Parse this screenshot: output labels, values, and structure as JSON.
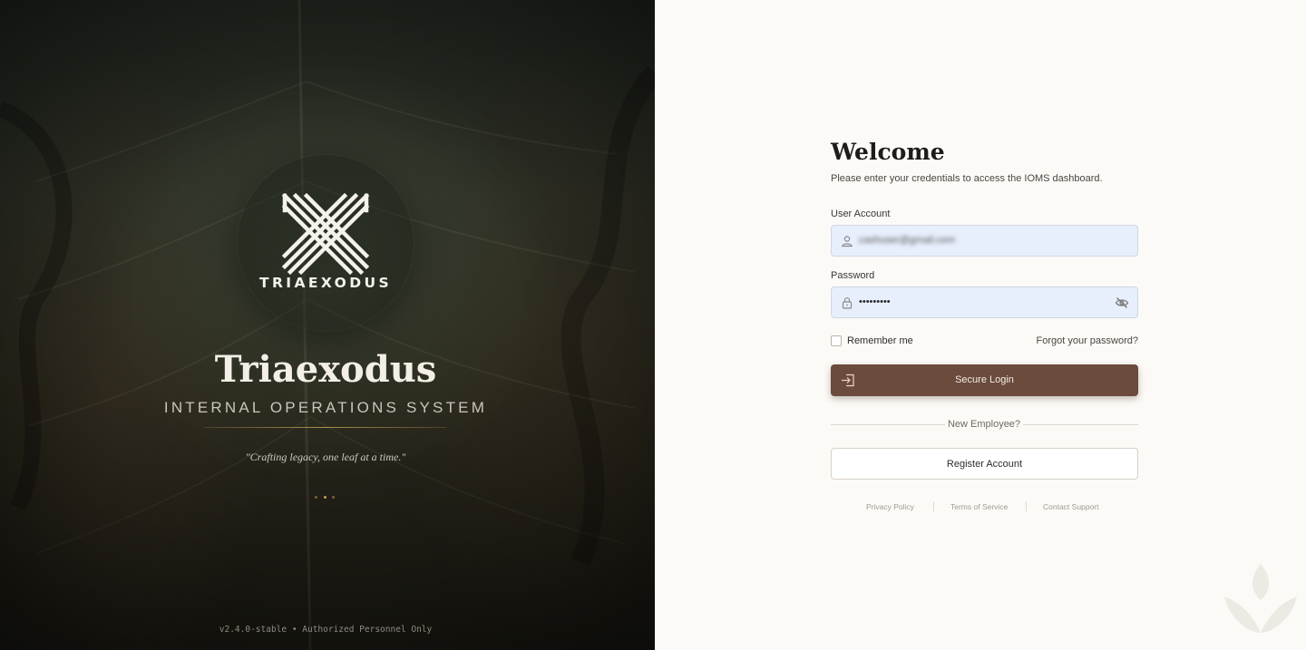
{
  "brand": {
    "logo_word": "TRIAEXODUS",
    "name": "Triaexodus",
    "subtitle": "INTERNAL OPERATIONS SYSTEM",
    "tagline": "\"Crafting legacy, one leaf at a time.\"",
    "version": "v2.4.0-stable • Authorized Personnel Only"
  },
  "login": {
    "title": "Welcome",
    "subtitle": "Please enter your credentials to access the IOMS dashboard.",
    "user_label": "User Account",
    "user_value": "cashuser@gmail.com",
    "password_label": "Password",
    "password_value": "•••••••••",
    "remember_label": "Remember me",
    "forgot_label": "Forgot your password?",
    "login_button": "Secure Login",
    "divider_text": "New Employee?",
    "register_button": "Register Account"
  },
  "footer": {
    "links": [
      "Privacy Policy",
      "Terms of Service",
      "Contact Support"
    ]
  },
  "colors": {
    "primary_button": "#6b4b3c",
    "input_background": "#e7effd",
    "accent_gold": "#c39a52",
    "page_background": "#fcfaf7"
  },
  "icons": [
    "user-icon",
    "lock-icon",
    "eye-off-icon",
    "login-icon",
    "leaf-watermark-icon",
    "triaexodus-logo"
  ]
}
